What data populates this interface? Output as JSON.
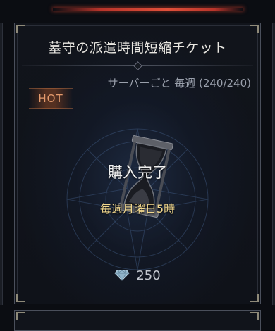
{
  "item": {
    "title": "墓守の派遣時間短縮チケット",
    "purchase_limit": "サーバーごと 毎週 (240/240)",
    "badge": "HOT",
    "status": "購入完了",
    "reset_schedule": "毎週月曜日5時",
    "price": "250",
    "price_icon": "diamond-icon"
  },
  "colors": {
    "accent_red": "#e0503a",
    "badge_text": "#e59b6d",
    "schedule_text": "#f2d88d"
  }
}
